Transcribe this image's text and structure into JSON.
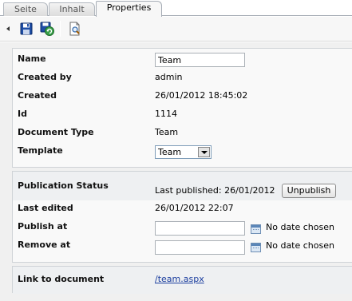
{
  "tabs": [
    {
      "label": "Seite",
      "active": false
    },
    {
      "label": "Inhalt",
      "active": false
    },
    {
      "label": "Properties",
      "active": true
    }
  ],
  "toolbar": {
    "icons": [
      "save-icon",
      "save-and-publish-icon",
      "preview-icon"
    ]
  },
  "properties": {
    "name_label": "Name",
    "name_value": "Team",
    "created_by_label": "Created by",
    "created_by_value": "admin",
    "created_label": "Created",
    "created_value": "26/01/2012 18:45:02",
    "id_label": "Id",
    "id_value": "1114",
    "doc_type_label": "Document Type",
    "doc_type_value": "Team",
    "template_label": "Template",
    "template_value": "Team"
  },
  "publication": {
    "status_label": "Publication Status",
    "status_value": "Last published: 26/01/2012",
    "unpublish_label": "Unpublish",
    "last_edited_label": "Last edited",
    "last_edited_value": "26/01/2012 22:07",
    "publish_at_label": "Publish at",
    "publish_at_value": "",
    "publish_at_note": "No date chosen",
    "remove_at_label": "Remove at",
    "remove_at_value": "",
    "remove_at_note": "No date chosen"
  },
  "link": {
    "label": "Link to document",
    "url": "/team.aspx"
  },
  "colors": {
    "link": "#1a3d9e",
    "panel_border": "#cfd3d7",
    "background": "#f0f0f0"
  }
}
